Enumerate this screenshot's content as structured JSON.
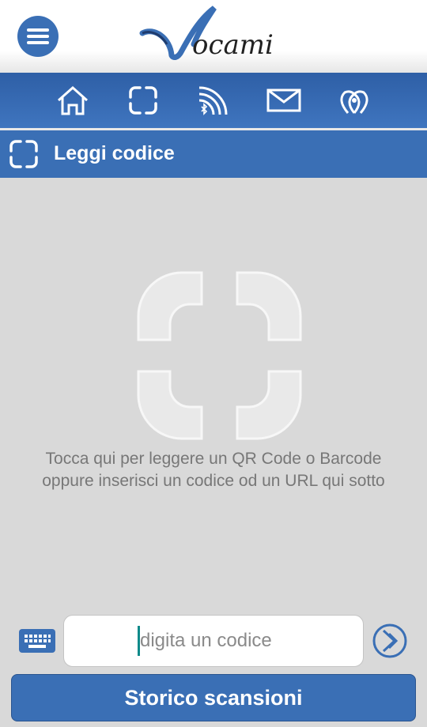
{
  "header": {
    "logo_text": "Vocami",
    "menu_icon": "hamburger-icon"
  },
  "nav": {
    "items": [
      "home-icon",
      "scan-icon",
      "nfc-bluetooth-icon",
      "mail-icon",
      "map-pins-icon"
    ]
  },
  "title_bar": {
    "title": "Leggi codice",
    "icon": "scan-icon"
  },
  "scan": {
    "hint_line1": "Tocca qui per leggere un QR Code o Barcode",
    "hint_line2": "oppure inserisci un codice od un URL qui sotto"
  },
  "input": {
    "placeholder": "digita un codice",
    "value": ""
  },
  "buttons": {
    "history_label": "Storico scansioni"
  },
  "colors": {
    "primary": "#3a6fb5",
    "background": "#d9d9d9",
    "caret": "#0e8a8a"
  }
}
